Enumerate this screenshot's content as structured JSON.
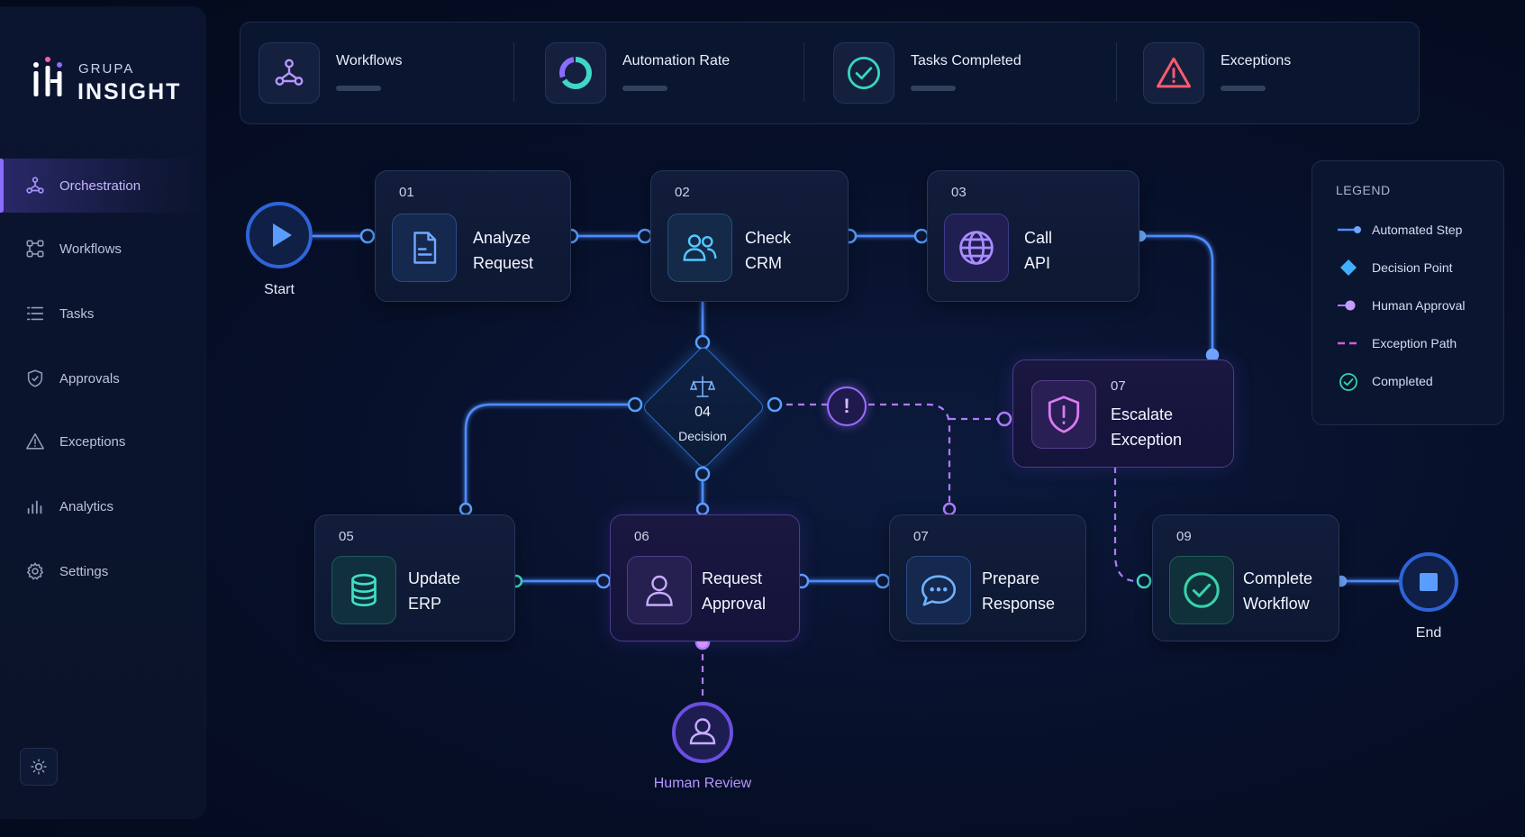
{
  "brand": {
    "line1": "GRUPA",
    "line2": "INSIGHT"
  },
  "sidebar": {
    "items": [
      {
        "label": "Orchestration",
        "icon": "orchestration-icon",
        "active": true
      },
      {
        "label": "Workflows",
        "icon": "workflows-icon"
      },
      {
        "label": "Tasks",
        "icon": "tasks-icon"
      },
      {
        "label": "Approvals",
        "icon": "shield-check-icon"
      },
      {
        "label": "Exceptions",
        "icon": "warning-icon"
      },
      {
        "label": "Analytics",
        "icon": "bar-chart-icon"
      },
      {
        "label": "Settings",
        "icon": "gear-icon"
      }
    ],
    "theme_toggle_icon": "sun-icon"
  },
  "stats": [
    {
      "title": "Workflows",
      "icon": "workflow-nodes-icon"
    },
    {
      "title": "Automation Rate",
      "icon": "donut-icon"
    },
    {
      "title": "Tasks Completed",
      "icon": "check-circle-icon"
    },
    {
      "title": "Exceptions",
      "icon": "warning-triangle-icon"
    }
  ],
  "legend": {
    "title": "LEGEND",
    "items": [
      {
        "label": "Automated Step",
        "color": "#4f8dff"
      },
      {
        "label": "Decision Point",
        "color": "#3fb0ff"
      },
      {
        "label": "Human Approval",
        "color": "#b07cff"
      },
      {
        "label": "Exception Path",
        "color": "#d85cd6"
      },
      {
        "label": "Completed",
        "color": "#36d3a8"
      }
    ]
  },
  "flow": {
    "start_label": "Start",
    "end_label": "End",
    "human_review_label": "Human Review",
    "steps": [
      {
        "num": "01",
        "line1": "Analyze",
        "line2": "Request",
        "icon": "document-icon"
      },
      {
        "num": "02",
        "line1": "Check",
        "line2": "CRM",
        "icon": "users-icon"
      },
      {
        "num": "03",
        "line1": "Call",
        "line2": "API",
        "icon": "globe-icon"
      },
      {
        "num": "05",
        "line1": "Update",
        "line2": "ERP",
        "icon": "database-icon"
      },
      {
        "num": "06",
        "line1": "Request",
        "line2": "Approval",
        "icon": "user-icon"
      },
      {
        "num": "07",
        "line1": "Prepare",
        "line2": "Response",
        "icon": "chat-icon"
      },
      {
        "num": "07",
        "line1": "Escalate",
        "line2": "Exception",
        "icon": "shield-alert-icon"
      },
      {
        "num": "09",
        "line1": "Complete",
        "line2": "Workflow",
        "icon": "check-circle-icon"
      }
    ],
    "decision": {
      "num": "04",
      "label": "Decision",
      "icon": "scales-icon"
    },
    "exception_marker": "!"
  },
  "colors": {
    "accent": "#8b6cff",
    "blue": "#4f8dff",
    "cyan": "#3fb8ff",
    "purple": "#b07cff",
    "magenta": "#d85cd6",
    "green": "#36d3a8",
    "red": "#ff5a6e"
  }
}
